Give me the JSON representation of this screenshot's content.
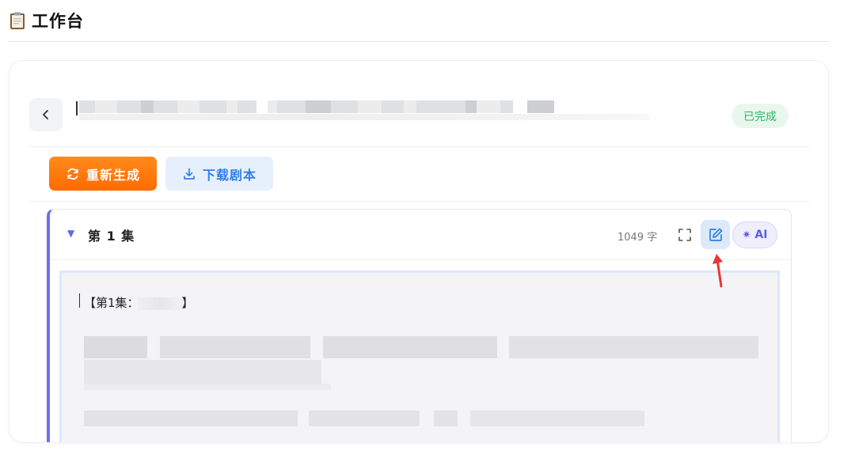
{
  "header": {
    "title": "工作台"
  },
  "script": {
    "status": "已完成",
    "actions": {
      "regenerate_label": "重新生成",
      "download_label": "下载剧本"
    },
    "episode": {
      "title": "第 1 集",
      "word_count": "1049 字",
      "ai_label": "AI",
      "heading_prefix": "【第1集：",
      "heading_suffix": "】"
    }
  },
  "colors": {
    "accent_orange": "#ff7a00",
    "primary_blue": "#2f7fe8",
    "status_green": "#2bb467",
    "episode_accent": "#6a6ef2",
    "annotation_red": "#e53935"
  },
  "icons": {
    "header": "clipboard-icon",
    "back": "chevron-left-icon",
    "regenerate": "refresh-icon",
    "download": "download-icon",
    "collapse": "triangle-down-icon",
    "fullscreen": "fullscreen-icon",
    "edit": "edit-icon",
    "ai": "sparkle-icon",
    "annotation": "red-arrow-icon"
  }
}
